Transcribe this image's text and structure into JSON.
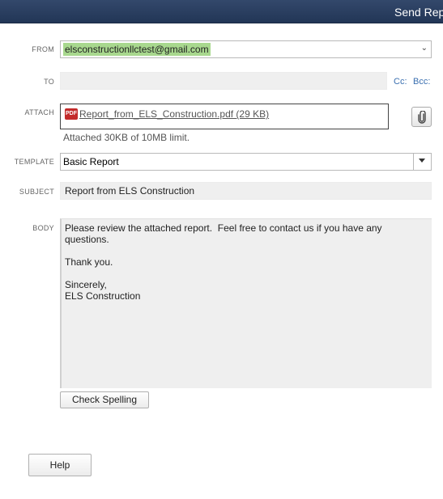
{
  "window": {
    "title": "Send Rep"
  },
  "from": {
    "label": "FROM",
    "value": "elsconstructionllctest@gmail.com"
  },
  "to": {
    "label": "TO",
    "value": "",
    "cc_label": "Cc:",
    "bcc_label": "Bcc:"
  },
  "attach": {
    "label": "ATTACH",
    "icon_text": "PDF",
    "file": "Report_from_ELS_Construction.pdf (29 KB)",
    "note": "Attached 30KB of 10MB limit."
  },
  "template": {
    "label": "TEMPLATE",
    "value": "Basic Report"
  },
  "subject": {
    "label": "SUBJECT",
    "value": "Report from ELS Construction"
  },
  "body": {
    "label": "BODY",
    "text": "Please review the attached report.  Feel free to contact us if you have any questions.\n\nThank you.\n\nSincerely,\nELS Construction"
  },
  "buttons": {
    "check_spelling": "Check Spelling",
    "help": "Help"
  },
  "colors": {
    "titlebar": "#2b3f60",
    "from_highlight": "#a8d88e",
    "link": "#3a6fb0",
    "pdf_icon": "#c32b2b"
  }
}
